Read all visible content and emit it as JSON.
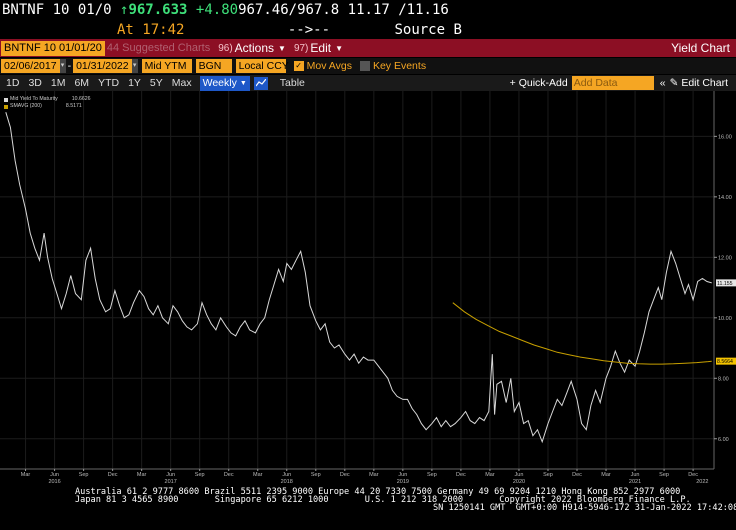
{
  "quote": {
    "ticker": "BNTNF 10 01/0",
    "price": "967.633",
    "change": "+4.80",
    "bid": "967.46",
    "ask": "/967.8",
    "yield_bid": "11.17",
    "yield_ask": "/11.16",
    "time": "At 17:42",
    "dashes": "-->--",
    "source": "Source B"
  },
  "toolbar": {
    "ticker_field": "BNTNF 10 01/01/20",
    "suggested": "44 Suggested Charts",
    "actions_num": "96)",
    "actions_label": "Actions",
    "edit_num": "97)",
    "edit_label": "Edit",
    "title": "Yield Chart"
  },
  "settings": {
    "start_date": "02/06/2017",
    "end_date": "01/31/2022",
    "field": "Mid YTM",
    "source": "BGN",
    "currency": "Local CCY",
    "mov_avgs_label": "Mov Avgs",
    "key_events_label": "Key Events"
  },
  "ranges": {
    "items": [
      "1D",
      "3D",
      "1M",
      "6M",
      "YTD",
      "1Y",
      "5Y",
      "Max"
    ],
    "frequency": "Weekly",
    "table_label": "Table",
    "quick_add_label": "+ Quick-Add",
    "add_data_placeholder": "Add Data",
    "edit_chart_label": "Edit Chart"
  },
  "legend": {
    "series1_name": "Mid Yield To Maturity",
    "series1_value": "10.6626",
    "series2_name": "SMAVG (200)",
    "series2_value": "8.5171"
  },
  "colors": {
    "yield_line": "#d8d8d8",
    "ma_line": "#c8a000",
    "amber": "#f5a623",
    "toolbar_red": "#8c0f24"
  },
  "chart_data": {
    "type": "line",
    "ylim": [
      5.0,
      17.5
    ],
    "yticks": [
      6.0,
      8.0,
      10.0,
      12.0,
      14.0,
      16.0
    ],
    "ytick_labels": [
      "6.00",
      "8.00",
      "10.00",
      "12.00",
      "14.00",
      "16.00"
    ],
    "x_month_labels": [
      {
        "t": 2016.17,
        "label": "Mar"
      },
      {
        "t": 2016.42,
        "label": "Jun"
      },
      {
        "t": 2016.67,
        "label": "Sep"
      },
      {
        "t": 2016.92,
        "label": "Dec"
      },
      {
        "t": 2017.17,
        "label": "Mar"
      },
      {
        "t": 2017.42,
        "label": "Jun"
      },
      {
        "t": 2017.67,
        "label": "Sep"
      },
      {
        "t": 2017.92,
        "label": "Dec"
      },
      {
        "t": 2018.17,
        "label": "Mar"
      },
      {
        "t": 2018.42,
        "label": "Jun"
      },
      {
        "t": 2018.67,
        "label": "Sep"
      },
      {
        "t": 2018.92,
        "label": "Dec"
      },
      {
        "t": 2019.17,
        "label": "Mar"
      },
      {
        "t": 2019.42,
        "label": "Jun"
      },
      {
        "t": 2019.67,
        "label": "Sep"
      },
      {
        "t": 2019.92,
        "label": "Dec"
      },
      {
        "t": 2020.17,
        "label": "Mar"
      },
      {
        "t": 2020.42,
        "label": "Jun"
      },
      {
        "t": 2020.67,
        "label": "Sep"
      },
      {
        "t": 2020.92,
        "label": "Dec"
      },
      {
        "t": 2021.17,
        "label": "Mar"
      },
      {
        "t": 2021.42,
        "label": "Jun"
      },
      {
        "t": 2021.67,
        "label": "Sep"
      },
      {
        "t": 2021.92,
        "label": "Dec"
      }
    ],
    "x_year_labels": [
      {
        "t": 2016.42,
        "label": "2016"
      },
      {
        "t": 2017.42,
        "label": "2017"
      },
      {
        "t": 2018.42,
        "label": "2018"
      },
      {
        "t": 2019.42,
        "label": "2019"
      },
      {
        "t": 2020.42,
        "label": "2020"
      },
      {
        "t": 2021.42,
        "label": "2021"
      },
      {
        "t": 2022.0,
        "label": "2022"
      }
    ],
    "xlim": [
      2015.95,
      2022.1
    ],
    "series": [
      {
        "name": "Mid Yield To Maturity",
        "last_label": "11.155",
        "points": [
          [
            2016.0,
            16.8
          ],
          [
            2016.04,
            16.3
          ],
          [
            2016.08,
            15.2
          ],
          [
            2016.12,
            14.4
          ],
          [
            2016.17,
            13.6
          ],
          [
            2016.21,
            12.8
          ],
          [
            2016.25,
            12.3
          ],
          [
            2016.29,
            11.9
          ],
          [
            2016.33,
            12.8
          ],
          [
            2016.36,
            12.0
          ],
          [
            2016.4,
            11.3
          ],
          [
            2016.44,
            10.8
          ],
          [
            2016.48,
            10.3
          ],
          [
            2016.52,
            10.8
          ],
          [
            2016.56,
            11.4
          ],
          [
            2016.6,
            10.8
          ],
          [
            2016.65,
            10.6
          ],
          [
            2016.69,
            11.9
          ],
          [
            2016.73,
            12.3
          ],
          [
            2016.77,
            11.3
          ],
          [
            2016.81,
            10.6
          ],
          [
            2016.86,
            10.2
          ],
          [
            2016.9,
            10.3
          ],
          [
            2016.94,
            10.9
          ],
          [
            2016.98,
            10.4
          ],
          [
            2017.02,
            10.0
          ],
          [
            2017.06,
            10.1
          ],
          [
            2017.1,
            10.5
          ],
          [
            2017.15,
            10.9
          ],
          [
            2017.19,
            10.7
          ],
          [
            2017.23,
            10.3
          ],
          [
            2017.27,
            10.1
          ],
          [
            2017.31,
            10.4
          ],
          [
            2017.35,
            10.0
          ],
          [
            2017.4,
            9.8
          ],
          [
            2017.44,
            10.4
          ],
          [
            2017.48,
            10.2
          ],
          [
            2017.52,
            9.9
          ],
          [
            2017.56,
            9.7
          ],
          [
            2017.6,
            9.6
          ],
          [
            2017.65,
            9.8
          ],
          [
            2017.69,
            10.5
          ],
          [
            2017.73,
            10.1
          ],
          [
            2017.77,
            9.8
          ],
          [
            2017.81,
            9.6
          ],
          [
            2017.85,
            10.0
          ],
          [
            2017.9,
            9.7
          ],
          [
            2017.94,
            9.5
          ],
          [
            2017.98,
            9.4
          ],
          [
            2018.02,
            9.7
          ],
          [
            2018.06,
            9.9
          ],
          [
            2018.1,
            9.6
          ],
          [
            2018.15,
            9.5
          ],
          [
            2018.19,
            9.8
          ],
          [
            2018.23,
            10.0
          ],
          [
            2018.27,
            10.6
          ],
          [
            2018.31,
            11.1
          ],
          [
            2018.35,
            11.6
          ],
          [
            2018.39,
            11.2
          ],
          [
            2018.42,
            11.8
          ],
          [
            2018.46,
            11.6
          ],
          [
            2018.5,
            11.9
          ],
          [
            2018.54,
            12.2
          ],
          [
            2018.58,
            11.5
          ],
          [
            2018.62,
            10.4
          ],
          [
            2018.67,
            9.9
          ],
          [
            2018.71,
            9.6
          ],
          [
            2018.75,
            9.8
          ],
          [
            2018.79,
            9.2
          ],
          [
            2018.83,
            9.0
          ],
          [
            2018.87,
            9.1
          ],
          [
            2018.92,
            8.8
          ],
          [
            2018.96,
            8.6
          ],
          [
            2019.0,
            8.8
          ],
          [
            2019.04,
            8.5
          ],
          [
            2019.08,
            8.7
          ],
          [
            2019.12,
            8.6
          ],
          [
            2019.17,
            8.6
          ],
          [
            2019.21,
            8.4
          ],
          [
            2019.25,
            8.2
          ],
          [
            2019.29,
            8.0
          ],
          [
            2019.33,
            7.6
          ],
          [
            2019.37,
            7.4
          ],
          [
            2019.42,
            7.3
          ],
          [
            2019.46,
            7.3
          ],
          [
            2019.5,
            7.0
          ],
          [
            2019.54,
            6.8
          ],
          [
            2019.58,
            6.5
          ],
          [
            2019.62,
            6.3
          ],
          [
            2019.67,
            6.5
          ],
          [
            2019.71,
            6.7
          ],
          [
            2019.75,
            6.4
          ],
          [
            2019.79,
            6.6
          ],
          [
            2019.83,
            6.4
          ],
          [
            2019.87,
            6.5
          ],
          [
            2019.92,
            6.7
          ],
          [
            2019.96,
            6.9
          ],
          [
            2020.0,
            6.6
          ],
          [
            2020.04,
            6.5
          ],
          [
            2020.08,
            6.7
          ],
          [
            2020.12,
            6.6
          ],
          [
            2020.16,
            6.9
          ],
          [
            2020.19,
            8.8
          ],
          [
            2020.21,
            6.8
          ],
          [
            2020.23,
            7.8
          ],
          [
            2020.27,
            7.9
          ],
          [
            2020.31,
            7.2
          ],
          [
            2020.35,
            8.0
          ],
          [
            2020.38,
            6.9
          ],
          [
            2020.42,
            7.2
          ],
          [
            2020.46,
            6.5
          ],
          [
            2020.5,
            6.6
          ],
          [
            2020.54,
            6.1
          ],
          [
            2020.58,
            6.3
          ],
          [
            2020.62,
            5.9
          ],
          [
            2020.67,
            6.5
          ],
          [
            2020.71,
            6.9
          ],
          [
            2020.75,
            7.3
          ],
          [
            2020.79,
            7.1
          ],
          [
            2020.83,
            7.5
          ],
          [
            2020.87,
            7.9
          ],
          [
            2020.92,
            7.3
          ],
          [
            2020.96,
            6.5
          ],
          [
            2021.0,
            6.3
          ],
          [
            2021.04,
            7.1
          ],
          [
            2021.08,
            7.6
          ],
          [
            2021.12,
            7.2
          ],
          [
            2021.17,
            8.0
          ],
          [
            2021.21,
            8.4
          ],
          [
            2021.25,
            8.9
          ],
          [
            2021.29,
            8.5
          ],
          [
            2021.33,
            8.2
          ],
          [
            2021.37,
            8.6
          ],
          [
            2021.42,
            8.4
          ],
          [
            2021.46,
            8.9
          ],
          [
            2021.5,
            9.5
          ],
          [
            2021.54,
            10.2
          ],
          [
            2021.58,
            10.6
          ],
          [
            2021.62,
            11.0
          ],
          [
            2021.65,
            10.6
          ],
          [
            2021.69,
            11.5
          ],
          [
            2021.73,
            12.2
          ],
          [
            2021.77,
            11.8
          ],
          [
            2021.81,
            11.3
          ],
          [
            2021.85,
            10.8
          ],
          [
            2021.88,
            11.1
          ],
          [
            2021.92,
            10.6
          ],
          [
            2021.96,
            11.2
          ],
          [
            2022.0,
            11.3
          ],
          [
            2022.04,
            11.2
          ],
          [
            2022.08,
            11.155
          ]
        ]
      },
      {
        "name": "SMAVG (200)",
        "last_label": "8.5664",
        "points": [
          [
            2019.85,
            10.5
          ],
          [
            2019.95,
            10.2
          ],
          [
            2020.05,
            9.95
          ],
          [
            2020.15,
            9.75
          ],
          [
            2020.25,
            9.55
          ],
          [
            2020.35,
            9.4
          ],
          [
            2020.45,
            9.25
          ],
          [
            2020.55,
            9.1
          ],
          [
            2020.65,
            8.98
          ],
          [
            2020.75,
            8.86
          ],
          [
            2020.85,
            8.78
          ],
          [
            2020.95,
            8.7
          ],
          [
            2021.05,
            8.64
          ],
          [
            2021.15,
            8.58
          ],
          [
            2021.25,
            8.54
          ],
          [
            2021.35,
            8.5
          ],
          [
            2021.45,
            8.48
          ],
          [
            2021.55,
            8.47
          ],
          [
            2021.65,
            8.47
          ],
          [
            2021.75,
            8.48
          ],
          [
            2021.85,
            8.5
          ],
          [
            2021.95,
            8.52
          ],
          [
            2022.05,
            8.55
          ],
          [
            2022.08,
            8.5664
          ]
        ]
      }
    ]
  },
  "footer": {
    "line1": "Australia 61 2 9777 8600 Brazil 5511 2395 9000 Europe 44 20 7330 7500 Germany 49 69 9204 1210 Hong Kong 852 2977 6000",
    "line2": "Japan 81 3 4565 8900       Singapore 65 6212 1000       U.S. 1 212 318 2000       Copyright 2022 Bloomberg Finance L.P.",
    "line3": "SN 1250141 GMT  GMT+0:00 H914-5946-172 31-Jan-2022 17:42:08"
  }
}
